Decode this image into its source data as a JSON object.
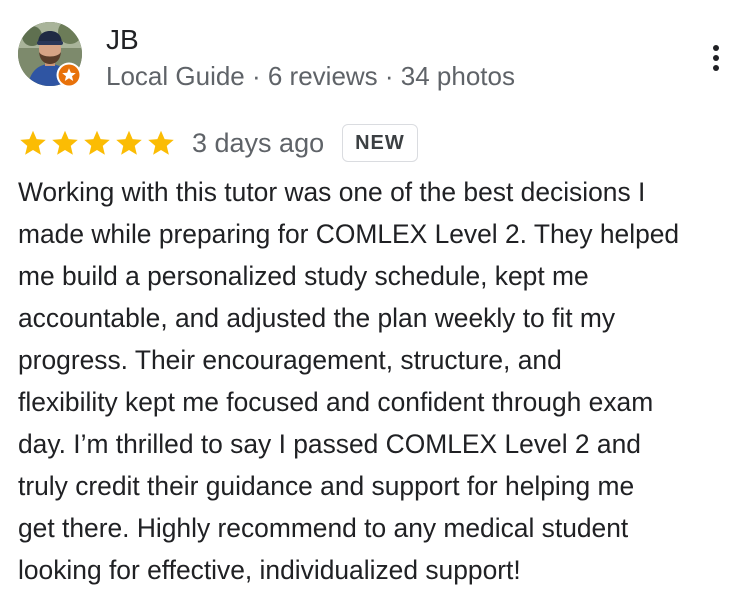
{
  "reviewer": {
    "name": "JB",
    "meta": "Local Guide · 6 reviews · 34 photos",
    "avatar_icon": "reviewer-photo",
    "badge_icon": "local-guide-star-icon"
  },
  "menu": {
    "icon": "more-vertical-icon"
  },
  "rating": {
    "stars": 5,
    "max_stars": 5,
    "star_color": "#fbbc04",
    "date": "3 days ago",
    "badge": "NEW"
  },
  "review": {
    "lines": [
      "Working with this tutor was one of the best decisions I",
      "made while preparing for COMLEX Level 2. They helped",
      "me build a personalized study schedule, kept me",
      "accountable, and adjusted the plan weekly to fit my",
      "progress. Their encouragement, structure, and",
      "flexibility kept me focused and confident through exam",
      "day. I’m thrilled to say I passed COMLEX Level 2 and",
      "truly credit their guidance and support for helping me",
      "get there. Highly recommend to any medical student",
      "looking for effective, individualized support!"
    ]
  },
  "colors": {
    "text_primary": "#202124",
    "text_secondary": "#5f6368",
    "badge_orange": "#e8710a"
  }
}
